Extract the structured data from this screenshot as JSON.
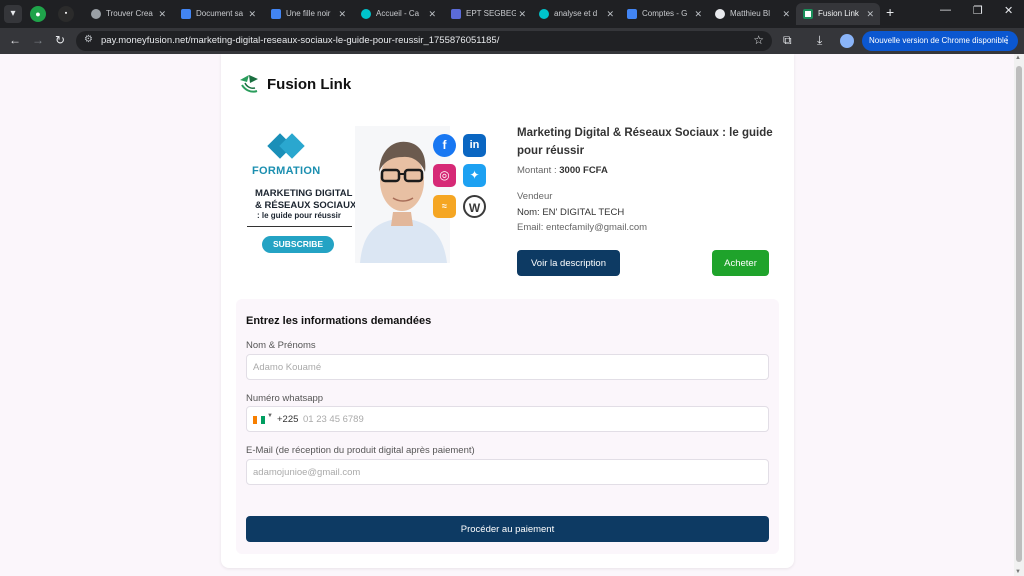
{
  "browser": {
    "pinned_tabs": [
      {
        "icon": "green-pinned-icon",
        "color": "#1fa34a"
      },
      {
        "icon": "pinned-app-icon",
        "color": "#2b2b2b"
      }
    ],
    "tabs": [
      {
        "label": "Trouver Crea",
        "icon": "web-icon",
        "active": false
      },
      {
        "label": "Document sa",
        "icon": "docs-icon",
        "active": false
      },
      {
        "label": "Une fille noir",
        "icon": "docs-icon",
        "active": false
      },
      {
        "label": "Accueil - Ca",
        "icon": "canva-icon",
        "active": false
      },
      {
        "label": "EPT SEGBEG",
        "icon": "shield-icon",
        "active": false
      },
      {
        "label": "analyse et d",
        "icon": "canva-icon",
        "active": false
      },
      {
        "label": "Comptes - G",
        "icon": "docs-icon",
        "active": false
      },
      {
        "label": "Matthieu Bl",
        "icon": "google-icon",
        "active": false
      },
      {
        "label": "Fusion Link",
        "icon": "fusionlink-icon",
        "active": true
      }
    ],
    "url": "pay.moneyfusion.net/marketing-digital-reseaux-sociaux-le-guide-pour-reussir_1755876051185/",
    "update_label": "Nouvelle version de Chrome disponible"
  },
  "page": {
    "brand": "Fusion Link",
    "banner": {
      "formation": "FORMATION",
      "title_line1": "MARKETING DIGITAL",
      "title_line2": "& RÉSEAUX SOCIAUX",
      "title_line3": ": le guide pour réussir",
      "subscribe": "SUBSCRIBE",
      "social_icons": [
        "facebook-icon",
        "linkedin-icon",
        "instagram-icon",
        "twitter-icon",
        "web-icon",
        "wordpress-icon"
      ]
    },
    "product": {
      "title": "Marketing Digital & Réseaux Sociaux : le guide pour réussir",
      "amount_label": "Montant :",
      "amount_value": "3000 FCFA",
      "vendor_label": "Vendeur",
      "vendor_name": "Nom: EN' DIGITAL TECH",
      "vendor_email": "Email: entecfamily@gmail.com"
    },
    "buttons": {
      "description": "Voir la description",
      "buy": "Acheter",
      "pay": "Procéder au paiement"
    },
    "form": {
      "title": "Entrez les informations demandées",
      "name_label": "Nom & Prénoms",
      "name_placeholder": "Adamo Kouamé",
      "phone_label": "Numéro whatsapp",
      "phone_dial": "+225",
      "phone_placeholder": "01 23 45 6789",
      "email_label": "E-Mail (de réception du produit digital après paiement)",
      "email_placeholder": "adamojunioe@gmail.com"
    },
    "colors": {
      "primary": "#0d3a63",
      "buy": "#1fa32b",
      "brand_teal": "#24a3c4"
    }
  }
}
